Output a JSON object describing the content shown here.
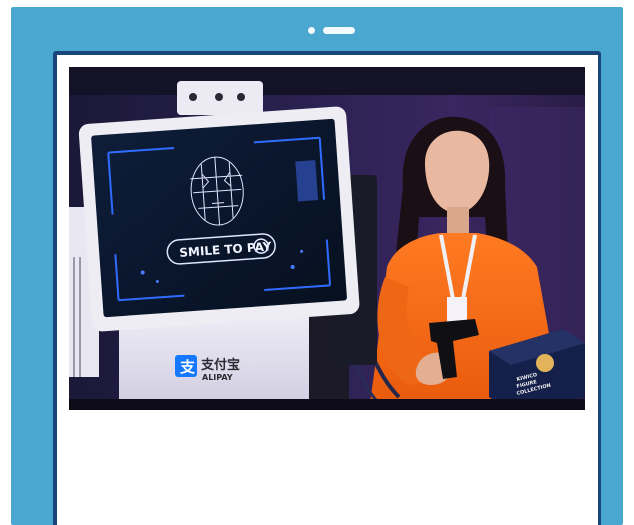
{
  "photo": {
    "kiosk_screen_text": "SMILE TO PAY",
    "brand_chinese": "支付宝",
    "brand_latin": "ALIPAY",
    "box_text_line1": "KIWICO",
    "box_text_line2": "FIGURE",
    "box_text_line3": "COLLECTION"
  }
}
